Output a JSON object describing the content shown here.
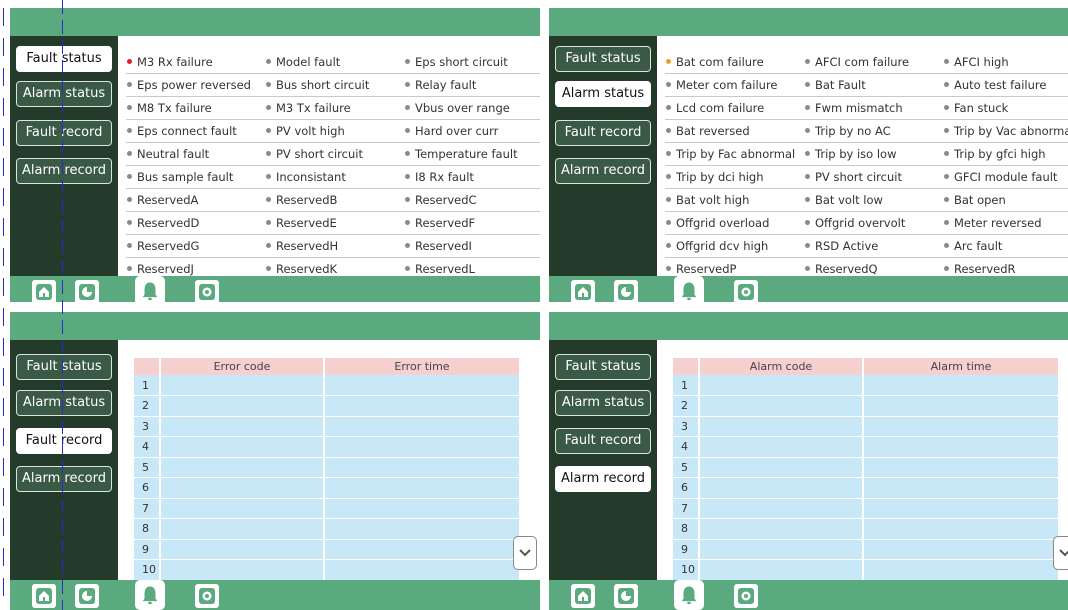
{
  "nav": {
    "fault_status": "Fault status",
    "alarm_status": "Alarm status",
    "fault_record": "Fault record",
    "alarm_record": "Alarm record"
  },
  "bottom_icons": [
    "home-icon",
    "chart-icon",
    "bell-icon",
    "gear-icon"
  ],
  "colors": {
    "green": "#5aa97f",
    "dark": "#243a2b",
    "red_dot": "#e02020",
    "orange_dot": "#f0a020",
    "header_pink": "#f6cfcf",
    "row_blue": "#c8e8f8"
  },
  "fault_status_items": [
    {
      "label": "M3 Rx failure",
      "dot": "red"
    },
    {
      "label": "Model fault",
      "dot": "gray"
    },
    {
      "label": "Eps short circuit",
      "dot": "gray"
    },
    {
      "label": "Eps power reversed",
      "dot": "gray"
    },
    {
      "label": "Bus short circuit",
      "dot": "gray"
    },
    {
      "label": "Relay fault",
      "dot": "gray"
    },
    {
      "label": "M8 Tx failure",
      "dot": "gray"
    },
    {
      "label": "M3 Tx failure",
      "dot": "gray"
    },
    {
      "label": "Vbus over range",
      "dot": "gray"
    },
    {
      "label": "Eps connect fault",
      "dot": "gray"
    },
    {
      "label": "PV volt high",
      "dot": "gray"
    },
    {
      "label": "Hard over curr",
      "dot": "gray"
    },
    {
      "label": "Neutral fault",
      "dot": "gray"
    },
    {
      "label": "PV short circuit",
      "dot": "gray"
    },
    {
      "label": "Temperature fault",
      "dot": "gray"
    },
    {
      "label": "Bus sample fault",
      "dot": "gray"
    },
    {
      "label": "Inconsistant",
      "dot": "gray"
    },
    {
      "label": "I8 Rx fault",
      "dot": "gray"
    },
    {
      "label": "ReservedA",
      "dot": "gray"
    },
    {
      "label": "ReservedB",
      "dot": "gray"
    },
    {
      "label": "ReservedC",
      "dot": "gray"
    },
    {
      "label": "ReservedD",
      "dot": "gray"
    },
    {
      "label": "ReservedE",
      "dot": "gray"
    },
    {
      "label": "ReservedF",
      "dot": "gray"
    },
    {
      "label": "ReservedG",
      "dot": "gray"
    },
    {
      "label": "ReservedH",
      "dot": "gray"
    },
    {
      "label": "ReservedI",
      "dot": "gray"
    },
    {
      "label": "ReservedJ",
      "dot": "gray"
    },
    {
      "label": "ReservedK",
      "dot": "gray"
    },
    {
      "label": "ReservedL",
      "dot": "gray"
    }
  ],
  "alarm_status_items": [
    {
      "label": "Bat com failure",
      "dot": "orange"
    },
    {
      "label": "AFCI com failure",
      "dot": "gray"
    },
    {
      "label": "AFCI high",
      "dot": "gray"
    },
    {
      "label": "Meter com failure",
      "dot": "gray"
    },
    {
      "label": "Bat Fault",
      "dot": "gray"
    },
    {
      "label": "Auto test failure",
      "dot": "gray"
    },
    {
      "label": "Lcd com failure",
      "dot": "gray"
    },
    {
      "label": "Fwm mismatch",
      "dot": "gray"
    },
    {
      "label": "Fan stuck",
      "dot": "gray"
    },
    {
      "label": "Bat reversed",
      "dot": "gray"
    },
    {
      "label": "Trip by no AC",
      "dot": "gray"
    },
    {
      "label": "Trip by Vac abnormal",
      "dot": "gray"
    },
    {
      "label": "Trip by Fac abnormal",
      "dot": "gray"
    },
    {
      "label": "Trip by iso low",
      "dot": "gray"
    },
    {
      "label": "Trip by gfci high",
      "dot": "gray"
    },
    {
      "label": "Trip by dci high",
      "dot": "gray"
    },
    {
      "label": "PV short circuit",
      "dot": "gray"
    },
    {
      "label": "GFCI module fault",
      "dot": "gray"
    },
    {
      "label": "Bat volt high",
      "dot": "gray"
    },
    {
      "label": "Bat volt low",
      "dot": "gray"
    },
    {
      "label": "Bat open",
      "dot": "gray"
    },
    {
      "label": "Offgrid overload",
      "dot": "gray"
    },
    {
      "label": "Offgrid overvolt",
      "dot": "gray"
    },
    {
      "label": "Meter reversed",
      "dot": "gray"
    },
    {
      "label": "Offgrid dcv high",
      "dot": "gray"
    },
    {
      "label": "RSD Active",
      "dot": "gray"
    },
    {
      "label": "Arc fault",
      "dot": "gray"
    },
    {
      "label": "ReservedP",
      "dot": "gray"
    },
    {
      "label": "ReservedQ",
      "dot": "gray"
    },
    {
      "label": "ReservedR",
      "dot": "gray"
    }
  ],
  "fault_record": {
    "col1": "Error code",
    "col2": "Error time",
    "rows": [
      "1",
      "2",
      "3",
      "4",
      "5",
      "6",
      "7",
      "8",
      "9",
      "10"
    ]
  },
  "alarm_record": {
    "col1": "Alarm code",
    "col2": "Alarm time",
    "rows": [
      "1",
      "2",
      "3",
      "4",
      "5",
      "6",
      "7",
      "8",
      "9",
      "10"
    ]
  }
}
